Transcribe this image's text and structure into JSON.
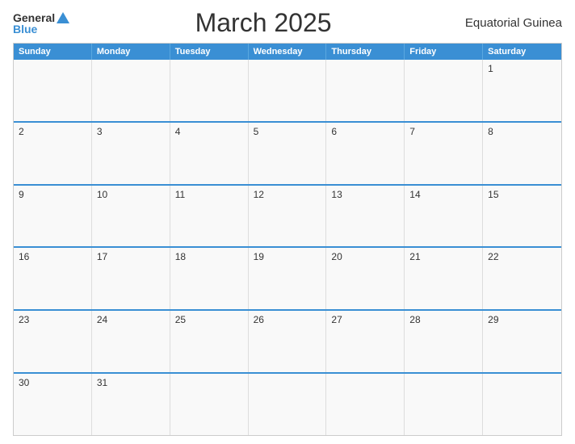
{
  "header": {
    "logo_general": "General",
    "logo_blue": "Blue",
    "title": "March 2025",
    "country": "Equatorial Guinea"
  },
  "days_of_week": [
    "Sunday",
    "Monday",
    "Tuesday",
    "Wednesday",
    "Thursday",
    "Friday",
    "Saturday"
  ],
  "weeks": [
    [
      null,
      null,
      null,
      null,
      null,
      null,
      1
    ],
    [
      2,
      3,
      4,
      5,
      6,
      7,
      8
    ],
    [
      9,
      10,
      11,
      12,
      13,
      14,
      15
    ],
    [
      16,
      17,
      18,
      19,
      20,
      21,
      22
    ],
    [
      23,
      24,
      25,
      26,
      27,
      28,
      29
    ],
    [
      30,
      31,
      null,
      null,
      null,
      null,
      null
    ]
  ],
  "colors": {
    "header_bg": "#3a8fd4",
    "header_text": "#ffffff",
    "border": "#3a8fd4",
    "cell_bg": "#f9f9f9",
    "title": "#333333"
  }
}
